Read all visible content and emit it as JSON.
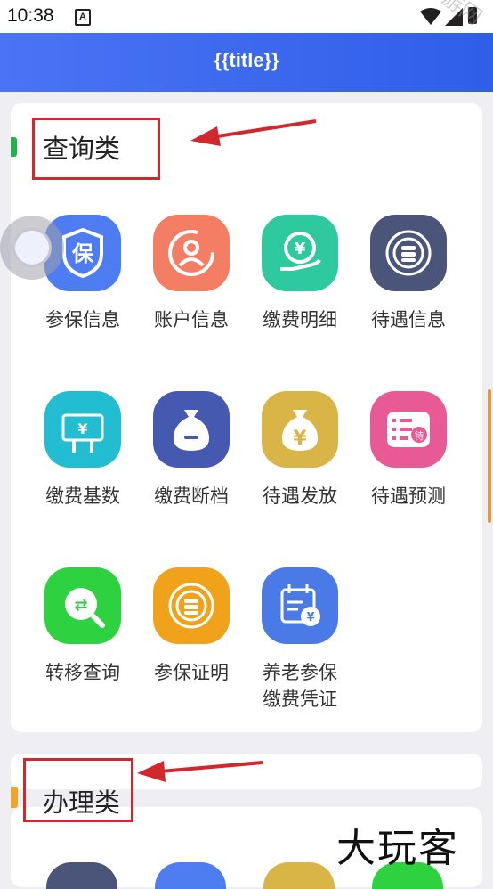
{
  "status_bar": {
    "time": "10:38",
    "notif_letter": "A",
    "watermark": "乐玩手游网"
  },
  "header": {
    "title": "{{title}}"
  },
  "section_query": {
    "title": "查询类",
    "accent_color": "#22b24c",
    "items": [
      {
        "label": "参保信息",
        "icon": "shield-bao-icon",
        "glyph": "保",
        "color": "#4d7df0"
      },
      {
        "label": "账户信息",
        "icon": "user-refresh-icon",
        "glyph": "◎",
        "color": "#f37e63"
      },
      {
        "label": "缴费明细",
        "icon": "yuan-hand-icon",
        "glyph": "¥",
        "color": "#2ec99e"
      },
      {
        "label": "待遇信息",
        "icon": "coin-stack-icon",
        "glyph": "◉",
        "color": "#4b5479"
      },
      {
        "label": "缴费基数",
        "icon": "hand-yuan-icon",
        "glyph": "¥",
        "color": "#22bdd0"
      },
      {
        "label": "缴费断档",
        "icon": "money-bag-minus-icon",
        "glyph": "−",
        "color": "#4659b1"
      },
      {
        "label": "待遇发放",
        "icon": "money-bag-yuan-icon",
        "glyph": "¥",
        "color": "#d9b547"
      },
      {
        "label": "待遇预测",
        "icon": "list-dai-icon",
        "glyph": "待",
        "color": "#e85a95"
      },
      {
        "label": "转移查询",
        "icon": "transfer-search-icon",
        "glyph": "⇄",
        "color": "#2ed240"
      },
      {
        "label": "参保证明",
        "icon": "coin-badge-icon",
        "glyph": "◉",
        "color": "#f1a21b"
      },
      {
        "label": "养老参保\n缴费凭证",
        "line1": "养老参保",
        "line2": "缴费凭证",
        "icon": "calendar-yuan-icon",
        "glyph": "¥",
        "color": "#4a7ae6"
      }
    ]
  },
  "section_handle": {
    "title": "办理类",
    "accent_color": "#f0a52a"
  },
  "brand": {
    "text": "大玩客"
  }
}
